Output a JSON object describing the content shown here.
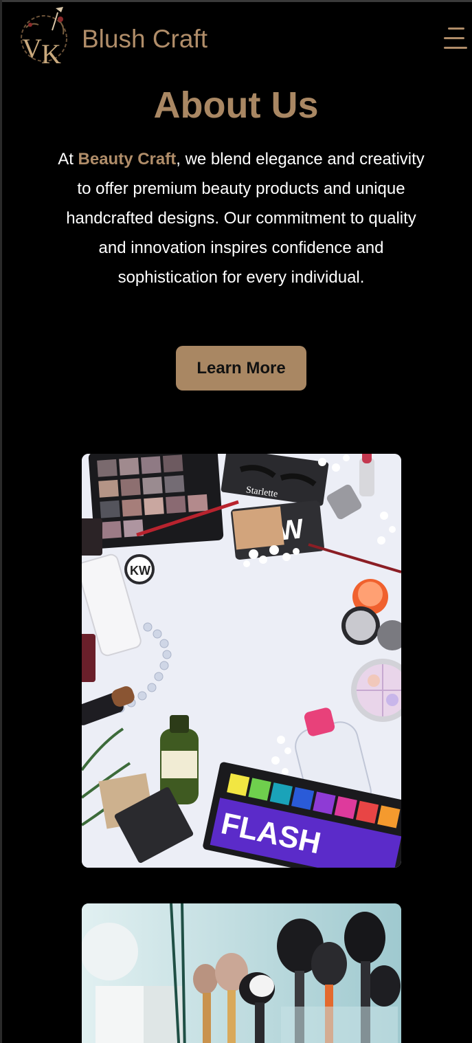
{
  "header": {
    "logo_icon": "vk-monogram-logo-icon",
    "brand_name": "Blush Craft",
    "menu_icon": "hamburger-menu-icon"
  },
  "about": {
    "title": "About Us",
    "text_prefix": "At ",
    "brand_highlight": "Beauty Craft",
    "text_suffix": ", we blend elegance and creativity to offer premium beauty products and unique handcrafted designs. Our commitment to quality and innovation inspires confidence and sophistication for every individual.",
    "button_label": "Learn More"
  },
  "images": [
    {
      "name": "makeup-flatlay-image",
      "labels": [
        "Starlette",
        "KW",
        "FLASH"
      ]
    },
    {
      "name": "makeup-brushes-image"
    }
  ],
  "colors": {
    "background": "#000000",
    "accent": "#a98763",
    "brand_text": "#b08d69",
    "body_text": "#ffffff"
  }
}
